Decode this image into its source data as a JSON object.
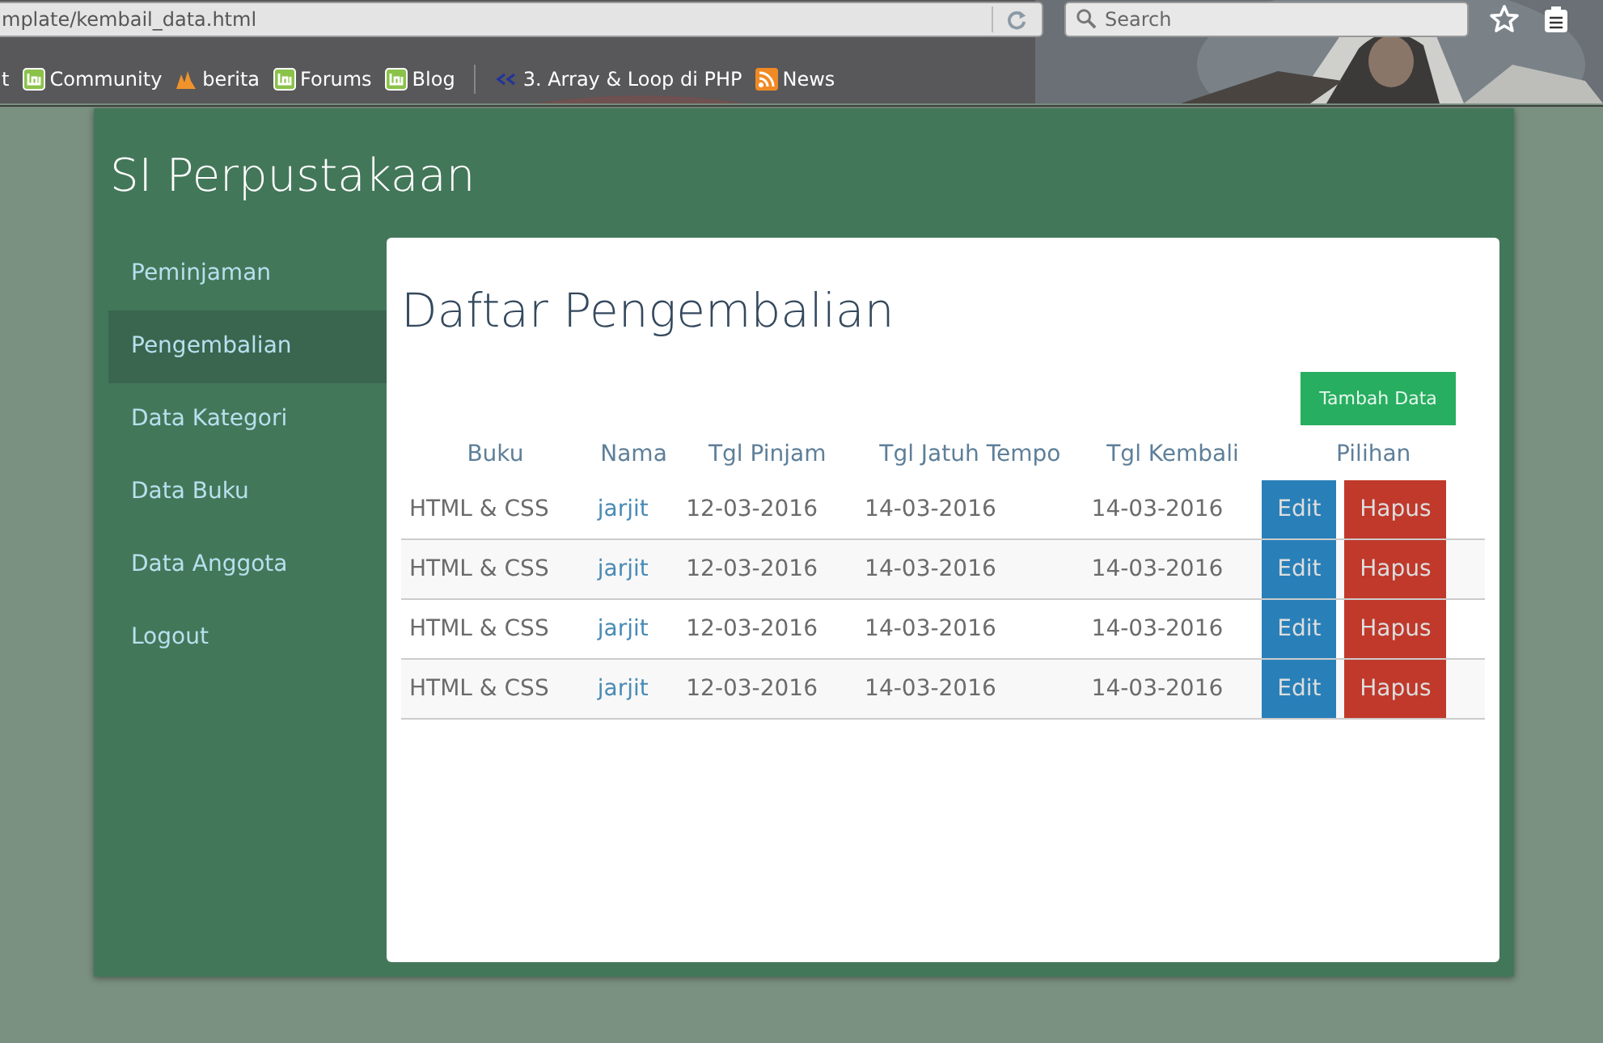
{
  "browser": {
    "address": "mplate/kembail_data.html",
    "search": {
      "placeholder": "Search"
    },
    "bookmarks": [
      {
        "label": "t",
        "kind": "plain",
        "separator_before": false
      },
      {
        "label": "Community",
        "kind": "mint",
        "separator_before": false
      },
      {
        "label": "berita",
        "kind": "flame",
        "separator_before": false
      },
      {
        "label": "Forums",
        "kind": "mint",
        "separator_before": false
      },
      {
        "label": "Blog",
        "kind": "mint",
        "separator_before": false
      },
      {
        "label": "3. Array & Loop di PHP",
        "kind": "code",
        "separator_before": true
      },
      {
        "label": "News",
        "kind": "rss",
        "separator_before": false
      }
    ]
  },
  "app": {
    "title": "SI Perpustakaan",
    "sidebar": {
      "items": [
        {
          "label": "Peminjaman",
          "selected": false
        },
        {
          "label": "Pengembalian",
          "selected": true
        },
        {
          "label": "Data Kategori",
          "selected": false
        },
        {
          "label": "Data Buku",
          "selected": false
        },
        {
          "label": "Data Anggota",
          "selected": false
        },
        {
          "label": "Logout",
          "selected": false
        }
      ]
    },
    "content": {
      "heading": "Daftar Pengembalian",
      "add_button": "Tambah Data",
      "table": {
        "columns": [
          "Buku",
          "Nama",
          "Tgl Pinjam",
          "Tgl Jatuh Tempo",
          "Tgl Kembali",
          "Pilihan"
        ],
        "rows": [
          {
            "buku": "HTML & CSS",
            "nama": "jarjit",
            "tgl_pinjam": "12-03-2016",
            "tgl_jatuh_tempo": "14-03-2016",
            "tgl_kembali": "14-03-2016",
            "actions": [
              "Edit",
              "Hapus"
            ]
          },
          {
            "buku": "HTML & CSS",
            "nama": "jarjit",
            "tgl_pinjam": "12-03-2016",
            "tgl_jatuh_tempo": "14-03-2016",
            "tgl_kembali": "14-03-2016",
            "actions": [
              "Edit",
              "Hapus"
            ]
          },
          {
            "buku": "HTML & CSS",
            "nama": "jarjit",
            "tgl_pinjam": "12-03-2016",
            "tgl_jatuh_tempo": "14-03-2016",
            "tgl_kembali": "14-03-2016",
            "actions": [
              "Edit",
              "Hapus"
            ]
          },
          {
            "buku": "HTML & CSS",
            "nama": "jarjit",
            "tgl_pinjam": "12-03-2016",
            "tgl_jatuh_tempo": "14-03-2016",
            "tgl_kembali": "14-03-2016",
            "actions": [
              "Edit",
              "Hapus"
            ]
          }
        ]
      }
    }
  }
}
